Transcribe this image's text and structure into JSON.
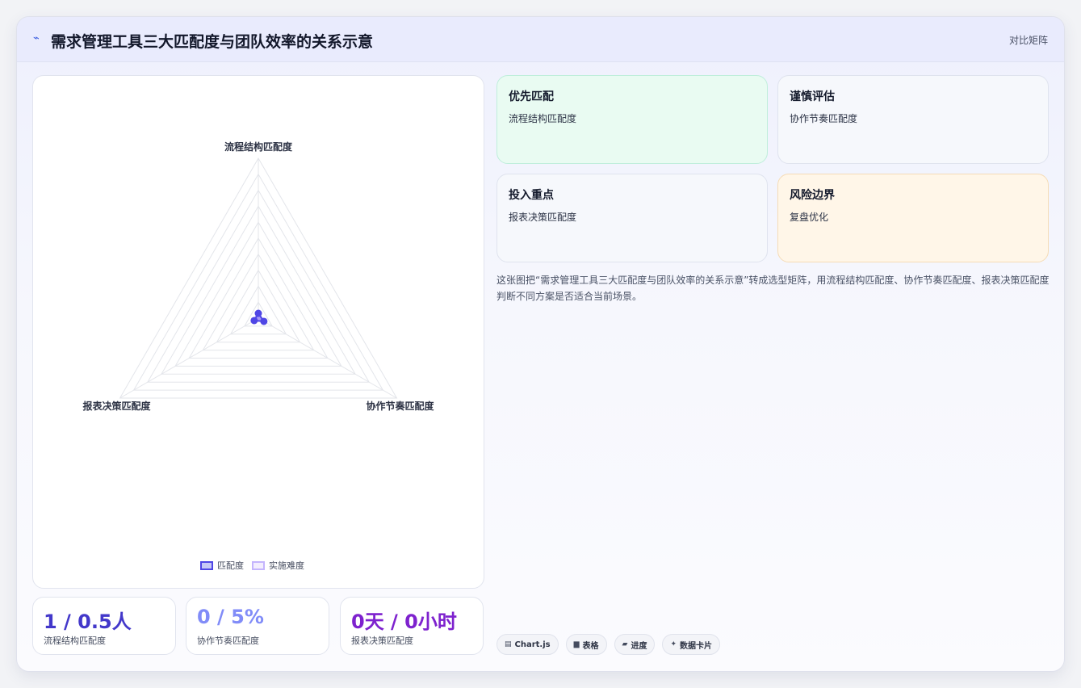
{
  "header": {
    "icon": "spark-line-icon",
    "title": "需求管理工具三大匹配度与团队效率的关系示意",
    "badge": "对比矩阵"
  },
  "chart_data": {
    "type": "radar",
    "axes": [
      "流程结构匹配度",
      "协作节奏匹配度",
      "报表决策匹配度"
    ],
    "r_max": 100,
    "grid_levels": 10,
    "series": [
      {
        "name": "匹配度",
        "values": [
          3,
          4,
          3
        ],
        "color": "#4f46e5"
      },
      {
        "name": "实施难度",
        "values": [
          0,
          0,
          0
        ],
        "color": "#c4b5fd"
      }
    ],
    "legend_position": "bottom"
  },
  "stats": [
    {
      "value": "1 / 0.5人",
      "label": "流程结构匹配度",
      "color": "#4338ca"
    },
    {
      "value": "0 / 5%",
      "label": "协作节奏匹配度",
      "color": "#818cf8"
    },
    {
      "value": "0天 / 0小时",
      "label": "报表决策匹配度",
      "color": "#7e22ce"
    }
  ],
  "quadrants": [
    {
      "title": "优先匹配",
      "text": "流程结构匹配度",
      "bg": "#e9fbf2",
      "border": "#bfeedb"
    },
    {
      "title": "谨慎评估",
      "text": "协作节奏匹配度",
      "bg": "#f6f8fc",
      "border": "#e0e4ee"
    },
    {
      "title": "投入重点",
      "text": "报表决策匹配度",
      "bg": "#f6f8fc",
      "border": "#e0e4ee"
    },
    {
      "title": "风险边界",
      "text": "复盘优化",
      "bg": "#fff6e8",
      "border": "#f5dcb6"
    }
  ],
  "description": "这张图把“需求管理工具三大匹配度与团队效率的关系示意”转成选型矩阵，用流程结构匹配度、协作节奏匹配度、报表决策匹配度判断不同方案是否适合当前场景。",
  "tags": [
    {
      "icon": "chart-icon",
      "glyph": "▤",
      "label": "Chart.js"
    },
    {
      "icon": "table-icon",
      "glyph": "▆",
      "label": "表格"
    },
    {
      "icon": "progress-icon",
      "glyph": "▰",
      "label": "进度"
    },
    {
      "icon": "sparkle-icon",
      "glyph": "✦",
      "label": "数据卡片"
    }
  ]
}
